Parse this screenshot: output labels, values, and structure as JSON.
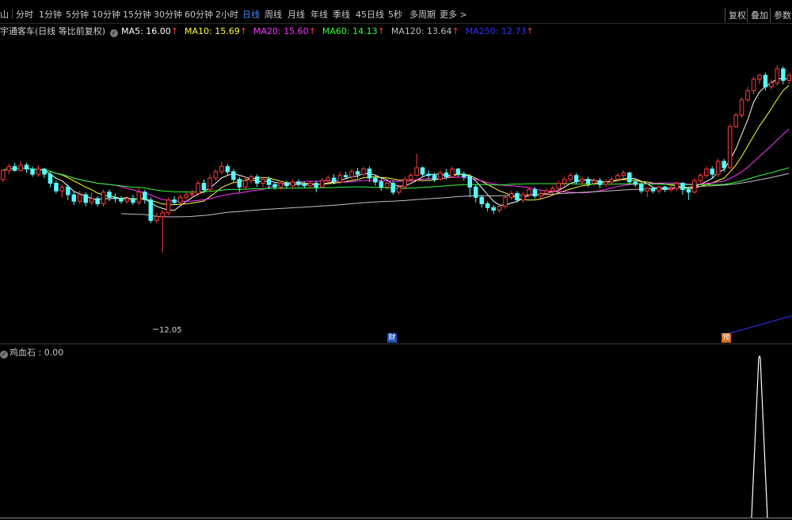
{
  "toolbar": {
    "tabs": [
      {
        "label": "分时",
        "active": false
      },
      {
        "label": "1分钟",
        "active": false
      },
      {
        "label": "5分钟",
        "active": false
      },
      {
        "label": "10分钟",
        "active": false
      },
      {
        "label": "15分钟",
        "active": false
      },
      {
        "label": "30分钟",
        "active": false
      },
      {
        "label": "60分钟",
        "active": false
      },
      {
        "label": "2小时",
        "active": false
      },
      {
        "label": "日线",
        "active": true
      },
      {
        "label": "周线",
        "active": false
      },
      {
        "label": "月线",
        "active": false
      },
      {
        "label": "年线",
        "active": false
      },
      {
        "label": "季线",
        "active": false
      },
      {
        "label": "45日线",
        "active": false
      },
      {
        "label": "5秒",
        "active": false
      },
      {
        "label": "多周期",
        "active": false
      },
      {
        "label": "更多 >",
        "active": false
      }
    ],
    "right_buttons": [
      "复权",
      "叠加",
      "参数"
    ]
  },
  "legend": {
    "stock": "宇通客车(日线 等比前复权)",
    "items": [
      {
        "label": "MA5: 16.00",
        "color": "#ffffff"
      },
      {
        "label": "MA10: 15.69",
        "color": "#ffff33"
      },
      {
        "label": "MA20: 15.60",
        "color": "#ff33ff"
      },
      {
        "label": "MA60: 14.13",
        "color": "#33ff33"
      },
      {
        "label": "MA120: 13.64",
        "color": "#c0c0c0"
      },
      {
        "label": "MA250: 12.73",
        "color": "#3333ff"
      }
    ],
    "arrow": "↑"
  },
  "annotations": {
    "low_price": "12.05",
    "fin_mark": "财",
    "pre_mark": "预"
  },
  "indicator": {
    "label": "鸡血石 : 0.00"
  },
  "colors": {
    "up": "#ff3b3b",
    "down": "#54ffff",
    "ma5": "#ffffff",
    "ma10": "#ffff33",
    "ma20": "#ff33ff",
    "ma60": "#33ff33",
    "ma120": "#c0c0c0",
    "ma250": "#3333ff"
  },
  "chart_data": {
    "type": "candlestick",
    "candles": [
      [
        14.9,
        15.25,
        14.8,
        15.3
      ],
      [
        15.25,
        15.4,
        15.1,
        15.5
      ],
      [
        15.4,
        15.25,
        15.2,
        15.55
      ],
      [
        15.25,
        15.45,
        15.2,
        15.6
      ],
      [
        15.45,
        15.3,
        15.15,
        15.55
      ],
      [
        15.3,
        15.1,
        15.0,
        15.4
      ],
      [
        15.1,
        15.3,
        15.0,
        15.45
      ],
      [
        15.3,
        15.1,
        14.95,
        15.35
      ],
      [
        15.1,
        14.75,
        14.6,
        15.2
      ],
      [
        14.75,
        14.45,
        14.35,
        14.85
      ],
      [
        14.45,
        14.6,
        14.2,
        14.7
      ],
      [
        14.6,
        14.3,
        14.1,
        14.7
      ],
      [
        14.3,
        14.05,
        13.9,
        14.4
      ],
      [
        14.05,
        14.3,
        13.95,
        14.45
      ],
      [
        14.3,
        14.0,
        13.85,
        14.4
      ],
      [
        14.0,
        14.15,
        13.9,
        14.4
      ],
      [
        14.15,
        13.95,
        13.85,
        14.25
      ],
      [
        13.95,
        14.4,
        13.85,
        14.5
      ],
      [
        14.4,
        14.2,
        14.05,
        14.5
      ],
      [
        14.2,
        14.15,
        14.0,
        14.35
      ],
      [
        14.15,
        14.05,
        13.95,
        14.25
      ],
      [
        14.05,
        14.15,
        13.95,
        14.25
      ],
      [
        14.15,
        14.0,
        13.9,
        14.3
      ],
      [
        14.0,
        14.4,
        13.9,
        14.6
      ],
      [
        14.4,
        14.1,
        13.95,
        14.5
      ],
      [
        14.1,
        13.3,
        13.2,
        14.2
      ],
      [
        13.3,
        13.45,
        13.2,
        13.6
      ],
      [
        13.45,
        13.6,
        12.05,
        13.7
      ],
      [
        13.6,
        14.1,
        13.5,
        14.2
      ],
      [
        14.1,
        14.0,
        13.9,
        14.25
      ],
      [
        14.0,
        14.2,
        13.9,
        14.3
      ],
      [
        14.2,
        14.3,
        14.1,
        14.45
      ],
      [
        14.3,
        14.35,
        14.2,
        14.5
      ],
      [
        14.35,
        14.75,
        14.25,
        14.85
      ],
      [
        14.75,
        14.5,
        14.35,
        14.9
      ],
      [
        14.5,
        14.95,
        14.4,
        15.1
      ],
      [
        14.95,
        15.2,
        14.85,
        15.3
      ],
      [
        15.2,
        15.4,
        15.1,
        15.6
      ],
      [
        15.4,
        15.2,
        15.05,
        15.5
      ],
      [
        15.2,
        14.9,
        14.8,
        15.3
      ],
      [
        14.9,
        14.6,
        14.4,
        15.0
      ],
      [
        14.6,
        14.85,
        14.5,
        15.0
      ],
      [
        14.85,
        15.0,
        14.75,
        15.1
      ],
      [
        15.0,
        14.75,
        14.6,
        15.1
      ],
      [
        14.75,
        14.9,
        14.6,
        15.0
      ],
      [
        14.9,
        14.7,
        14.55,
        15.0
      ],
      [
        14.7,
        14.6,
        14.5,
        14.8
      ],
      [
        14.6,
        14.75,
        14.5,
        14.85
      ],
      [
        14.75,
        14.65,
        14.55,
        14.85
      ],
      [
        14.65,
        14.8,
        14.55,
        14.9
      ],
      [
        14.8,
        14.7,
        14.6,
        14.9
      ],
      [
        14.7,
        14.65,
        14.55,
        14.8
      ],
      [
        14.65,
        14.75,
        14.55,
        14.85
      ],
      [
        14.75,
        14.6,
        14.4,
        14.85
      ],
      [
        14.6,
        14.85,
        14.55,
        14.95
      ],
      [
        14.85,
        14.95,
        14.75,
        15.05
      ],
      [
        14.95,
        14.8,
        14.7,
        15.1
      ],
      [
        14.8,
        15.05,
        14.7,
        15.2
      ],
      [
        15.05,
        15.0,
        14.9,
        15.2
      ],
      [
        15.0,
        15.2,
        14.9,
        15.3
      ],
      [
        15.2,
        15.1,
        14.95,
        15.35
      ],
      [
        15.1,
        15.3,
        15.0,
        15.4
      ],
      [
        15.3,
        14.95,
        14.8,
        15.4
      ],
      [
        14.95,
        14.8,
        14.65,
        15.05
      ],
      [
        14.8,
        14.6,
        14.45,
        14.9
      ],
      [
        14.6,
        14.75,
        14.5,
        14.85
      ],
      [
        14.75,
        14.4,
        14.3,
        14.85
      ],
      [
        14.4,
        14.6,
        14.3,
        14.7
      ],
      [
        14.6,
        14.9,
        14.5,
        15.0
      ],
      [
        14.9,
        15.05,
        14.8,
        15.15
      ],
      [
        15.05,
        15.35,
        15.0,
        15.9
      ],
      [
        15.35,
        15.1,
        15.0,
        15.4
      ],
      [
        15.1,
        15.05,
        14.9,
        15.25
      ],
      [
        15.05,
        14.9,
        14.8,
        15.15
      ],
      [
        14.9,
        15.15,
        14.85,
        15.25
      ],
      [
        15.15,
        15.0,
        14.9,
        15.3
      ],
      [
        15.0,
        15.3,
        14.95,
        15.4
      ],
      [
        15.3,
        15.1,
        15.0,
        15.35
      ],
      [
        15.1,
        15.0,
        14.85,
        15.2
      ],
      [
        15.0,
        14.6,
        14.2,
        15.1
      ],
      [
        14.6,
        14.2,
        14.0,
        14.7
      ],
      [
        14.2,
        13.95,
        13.8,
        14.3
      ],
      [
        13.95,
        13.8,
        13.65,
        14.05
      ],
      [
        13.8,
        13.7,
        13.55,
        13.9
      ],
      [
        13.7,
        13.85,
        13.6,
        13.95
      ],
      [
        13.85,
        14.2,
        13.75,
        14.3
      ],
      [
        14.2,
        14.35,
        14.1,
        14.45
      ],
      [
        14.35,
        14.1,
        14.0,
        14.45
      ],
      [
        14.1,
        14.3,
        14.0,
        14.4
      ],
      [
        14.3,
        14.5,
        14.2,
        14.6
      ],
      [
        14.5,
        14.25,
        14.15,
        14.6
      ],
      [
        14.25,
        14.35,
        14.15,
        14.45
      ],
      [
        14.35,
        14.45,
        14.25,
        14.55
      ],
      [
        14.45,
        14.55,
        14.35,
        14.65
      ],
      [
        14.55,
        14.75,
        14.45,
        14.85
      ],
      [
        14.75,
        14.9,
        14.65,
        15.0
      ],
      [
        14.9,
        15.05,
        14.8,
        15.15
      ],
      [
        15.05,
        14.8,
        14.7,
        15.15
      ],
      [
        14.8,
        14.9,
        14.7,
        15.0
      ],
      [
        14.9,
        14.75,
        14.6,
        15.0
      ],
      [
        14.75,
        14.85,
        14.65,
        14.95
      ],
      [
        14.85,
        14.7,
        14.55,
        14.95
      ],
      [
        14.7,
        14.8,
        14.6,
        14.9
      ],
      [
        14.8,
        14.9,
        14.7,
        15.0
      ],
      [
        14.9,
        15.05,
        14.8,
        15.15
      ],
      [
        15.05,
        15.15,
        14.95,
        15.25
      ],
      [
        15.15,
        14.8,
        14.7,
        15.2
      ],
      [
        14.8,
        14.7,
        14.6,
        14.9
      ],
      [
        14.7,
        14.45,
        14.35,
        14.8
      ],
      [
        14.45,
        14.55,
        14.2,
        14.6
      ],
      [
        14.55,
        14.45,
        14.35,
        14.6
      ],
      [
        14.45,
        14.6,
        14.35,
        14.65
      ],
      [
        14.6,
        14.5,
        14.4,
        14.65
      ],
      [
        14.5,
        14.55,
        14.4,
        14.7
      ],
      [
        14.55,
        14.75,
        14.45,
        14.8
      ],
      [
        14.75,
        14.5,
        14.3,
        14.8
      ],
      [
        14.5,
        14.4,
        14.1,
        14.6
      ],
      [
        14.4,
        14.85,
        14.35,
        14.95
      ],
      [
        14.85,
        15.05,
        14.75,
        15.15
      ],
      [
        15.05,
        15.3,
        14.95,
        15.4
      ],
      [
        15.3,
        15.1,
        14.95,
        15.4
      ],
      [
        15.1,
        15.6,
        15.0,
        15.7
      ],
      [
        15.6,
        15.35,
        15.2,
        15.7
      ],
      [
        15.35,
        16.95,
        15.3,
        17.05
      ],
      [
        16.95,
        17.4,
        16.9,
        17.5
      ],
      [
        17.4,
        18.0,
        17.3,
        18.1
      ],
      [
        18.0,
        18.35,
        17.9,
        18.5
      ],
      [
        18.35,
        18.8,
        18.2,
        18.9
      ],
      [
        18.8,
        18.95,
        18.6,
        19.0
      ],
      [
        18.95,
        18.5,
        18.35,
        19.05
      ],
      [
        18.5,
        18.65,
        18.4,
        18.8
      ],
      [
        18.65,
        19.2,
        18.55,
        19.35
      ],
      [
        19.2,
        18.75,
        18.6,
        19.3
      ],
      [
        18.75,
        18.95,
        18.6,
        19.05
      ]
    ],
    "ma": {
      "MA5": {
        "label": "MA5",
        "value": 16.0
      },
      "MA10": {
        "label": "MA10",
        "value": 15.69
      },
      "MA20": {
        "label": "MA20",
        "value": 15.6
      },
      "MA60": {
        "label": "MA60",
        "value": 14.13
      },
      "MA120": {
        "label": "MA120",
        "value": 13.64
      },
      "MA250": {
        "label": "MA250",
        "value": 12.73
      }
    },
    "ylim": [
      11.9,
      19.6
    ],
    "indicator_series": {
      "name": "鸡血石",
      "spike_index": 128,
      "value": 0.0
    }
  }
}
